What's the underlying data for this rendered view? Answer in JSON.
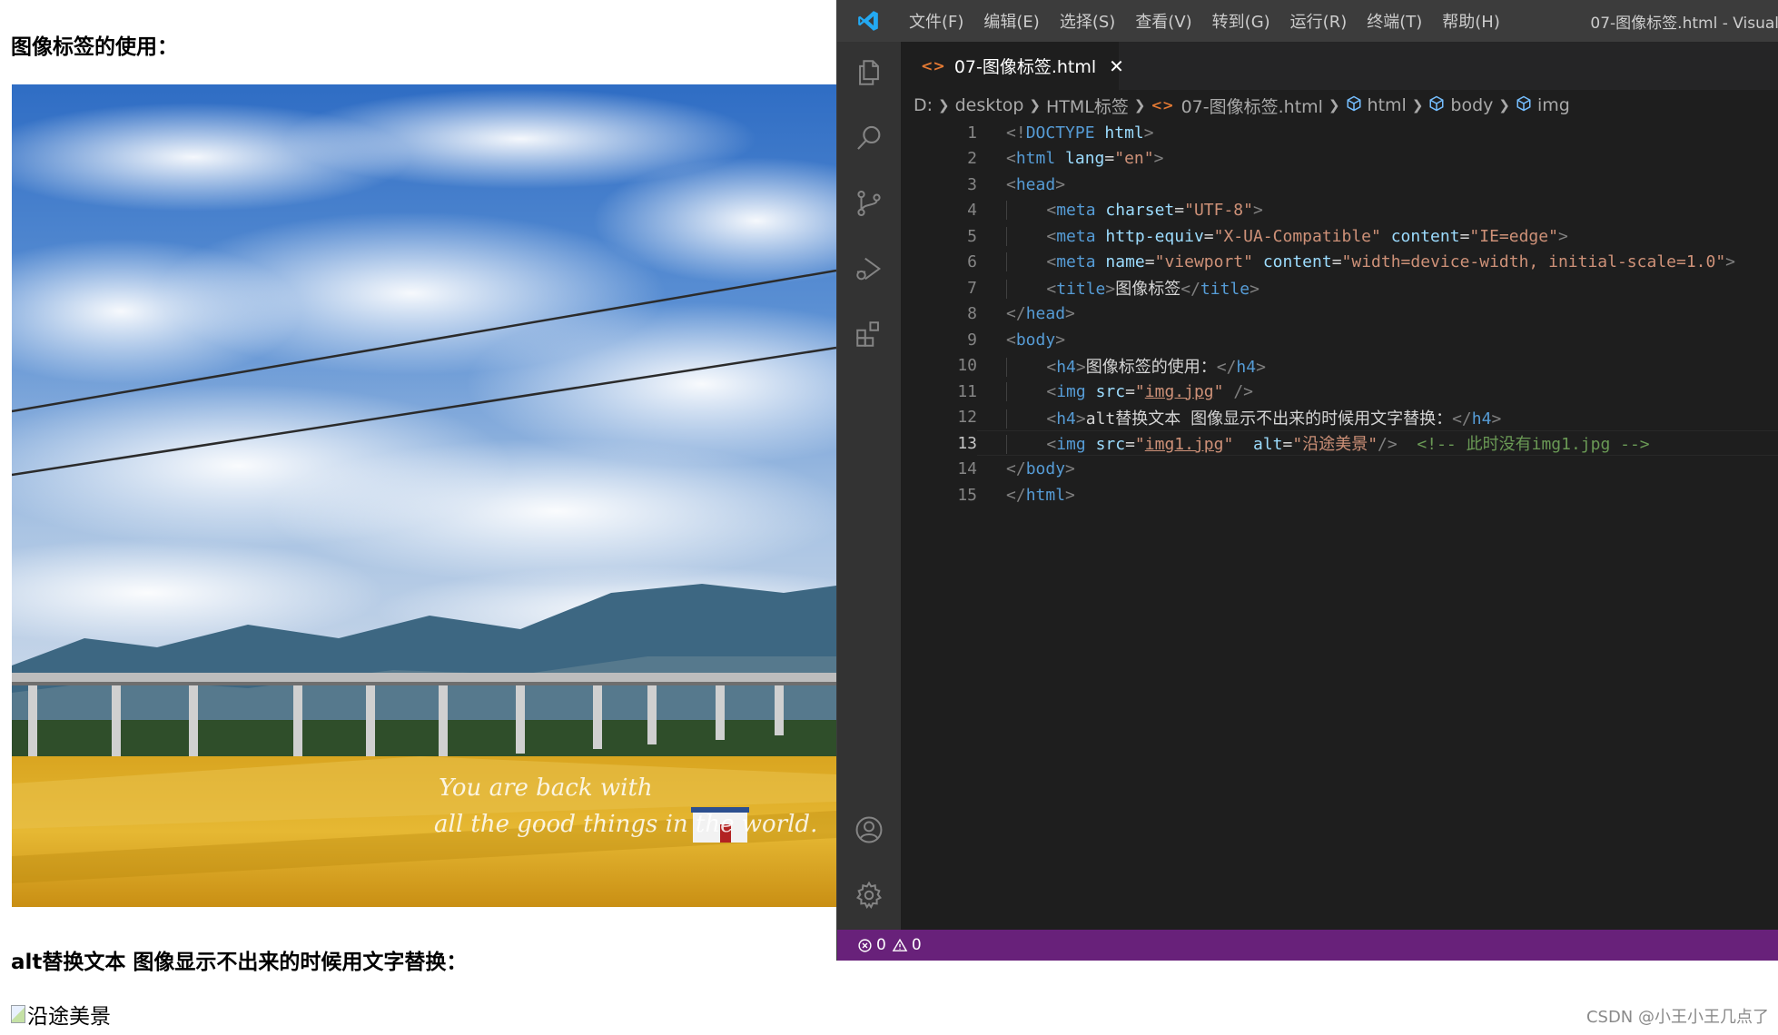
{
  "browser": {
    "heading_image_usage": "图像标签的使用：",
    "photo_caption_line1": "You are back with",
    "photo_caption_line2": "all the good things in the world.",
    "heading_alt_text": "alt替换文本 图像显示不出来的时候用文字替换：",
    "broken_image_alt": "沿途美景"
  },
  "vscode": {
    "menu": [
      "文件(F)",
      "编辑(E)",
      "选择(S)",
      "查看(V)",
      "转到(G)",
      "运行(R)",
      "终端(T)",
      "帮助(H)"
    ],
    "window_title": "07-图像标签.html - Visual",
    "active_tab": "07-图像标签.html",
    "breadcrumb": [
      "D:",
      "desktop",
      "HTML标签",
      "07-图像标签.html",
      "html",
      "body",
      "img"
    ],
    "current_line": 13,
    "status": {
      "errors": "0",
      "warnings": "0"
    },
    "code_lines": [
      {
        "n": "1",
        "tokens": [
          [
            "ang",
            "<!"
          ],
          [
            "tag",
            "DOCTYPE"
          ],
          [
            "text",
            " "
          ],
          [
            "attr",
            "html"
          ],
          [
            "ang",
            ">"
          ]
        ]
      },
      {
        "n": "2",
        "tokens": [
          [
            "ang",
            "<"
          ],
          [
            "tag",
            "html"
          ],
          [
            "text",
            " "
          ],
          [
            "attr",
            "lang"
          ],
          [
            "text",
            "="
          ],
          [
            "str",
            "\"en\""
          ],
          [
            "ang",
            ">"
          ]
        ]
      },
      {
        "n": "3",
        "tokens": [
          [
            "ang",
            "<"
          ],
          [
            "tag",
            "head"
          ],
          [
            "ang",
            ">"
          ]
        ]
      },
      {
        "n": "4",
        "indent": true,
        "tokens": [
          [
            "ang",
            "<"
          ],
          [
            "tag",
            "meta"
          ],
          [
            "text",
            " "
          ],
          [
            "attr",
            "charset"
          ],
          [
            "text",
            "="
          ],
          [
            "str",
            "\"UTF-8\""
          ],
          [
            "ang",
            ">"
          ]
        ]
      },
      {
        "n": "5",
        "indent": true,
        "tokens": [
          [
            "ang",
            "<"
          ],
          [
            "tag",
            "meta"
          ],
          [
            "text",
            " "
          ],
          [
            "attr",
            "http-equiv"
          ],
          [
            "text",
            "="
          ],
          [
            "str",
            "\"X-UA-Compatible\""
          ],
          [
            "text",
            " "
          ],
          [
            "attr",
            "content"
          ],
          [
            "text",
            "="
          ],
          [
            "str",
            "\"IE=edge\""
          ],
          [
            "ang",
            ">"
          ]
        ]
      },
      {
        "n": "6",
        "indent": true,
        "tokens": [
          [
            "ang",
            "<"
          ],
          [
            "tag",
            "meta"
          ],
          [
            "text",
            " "
          ],
          [
            "attr",
            "name"
          ],
          [
            "text",
            "="
          ],
          [
            "str",
            "\"viewport\""
          ],
          [
            "text",
            " "
          ],
          [
            "attr",
            "content"
          ],
          [
            "text",
            "="
          ],
          [
            "str",
            "\"width=device-width, initial-scale=1.0\""
          ],
          [
            "ang",
            ">"
          ]
        ]
      },
      {
        "n": "7",
        "indent": true,
        "tokens": [
          [
            "ang",
            "<"
          ],
          [
            "tag",
            "title"
          ],
          [
            "ang",
            ">"
          ],
          [
            "text",
            "图像标签"
          ],
          [
            "ang",
            "</"
          ],
          [
            "tag",
            "title"
          ],
          [
            "ang",
            ">"
          ]
        ]
      },
      {
        "n": "8",
        "tokens": [
          [
            "ang",
            "</"
          ],
          [
            "tag",
            "head"
          ],
          [
            "ang",
            ">"
          ]
        ]
      },
      {
        "n": "9",
        "tokens": [
          [
            "ang",
            "<"
          ],
          [
            "tag",
            "body"
          ],
          [
            "ang",
            ">"
          ]
        ]
      },
      {
        "n": "10",
        "indent": true,
        "tokens": [
          [
            "ang",
            "<"
          ],
          [
            "tag",
            "h4"
          ],
          [
            "ang",
            ">"
          ],
          [
            "text",
            "图像标签的使用："
          ],
          [
            "ang",
            "</"
          ],
          [
            "tag",
            "h4"
          ],
          [
            "ang",
            ">"
          ]
        ]
      },
      {
        "n": "11",
        "indent": true,
        "tokens": [
          [
            "ang",
            "<"
          ],
          [
            "tag",
            "img"
          ],
          [
            "text",
            " "
          ],
          [
            "attr",
            "src"
          ],
          [
            "text",
            "="
          ],
          [
            "str",
            "\""
          ],
          [
            "link",
            "img.jpg"
          ],
          [
            "str",
            "\""
          ],
          [
            "text",
            " "
          ],
          [
            "ang",
            "/>"
          ]
        ]
      },
      {
        "n": "12",
        "indent": true,
        "tokens": [
          [
            "ang",
            "<"
          ],
          [
            "tag",
            "h4"
          ],
          [
            "ang",
            ">"
          ],
          [
            "text",
            "alt替换文本 图像显示不出来的时候用文字替换："
          ],
          [
            "ang",
            "</"
          ],
          [
            "tag",
            "h4"
          ],
          [
            "ang",
            ">"
          ]
        ]
      },
      {
        "n": "13",
        "indent": true,
        "tokens": [
          [
            "ang",
            "<"
          ],
          [
            "tag",
            "img"
          ],
          [
            "text",
            " "
          ],
          [
            "attr",
            "src"
          ],
          [
            "text",
            "="
          ],
          [
            "str",
            "\""
          ],
          [
            "link",
            "img1.jpg"
          ],
          [
            "str",
            "\""
          ],
          [
            "text",
            "  "
          ],
          [
            "attr",
            "alt"
          ],
          [
            "text",
            "="
          ],
          [
            "str",
            "\"沿途美景\""
          ],
          [
            "ang",
            "/>"
          ],
          [
            "text",
            "  "
          ],
          [
            "comment",
            "<!-- 此时没有img1.jpg -->"
          ]
        ]
      },
      {
        "n": "14",
        "tokens": [
          [
            "ang",
            "</"
          ],
          [
            "tag",
            "body"
          ],
          [
            "ang",
            ">"
          ]
        ]
      },
      {
        "n": "15",
        "tokens": [
          [
            "ang",
            "</"
          ],
          [
            "tag",
            "html"
          ],
          [
            "ang",
            ">"
          ]
        ]
      }
    ]
  },
  "watermark": "CSDN @小王小王几点了",
  "colors": {
    "title_bar": "#3c3c3c",
    "activity_bar": "#333333",
    "editor_bg": "#1e1e1e",
    "status_bar": "#68217a",
    "html_icon": "#e37933",
    "tag": "#569cd6",
    "attribute": "#9cdcfe",
    "string": "#ce9178",
    "comment": "#6a9955"
  }
}
